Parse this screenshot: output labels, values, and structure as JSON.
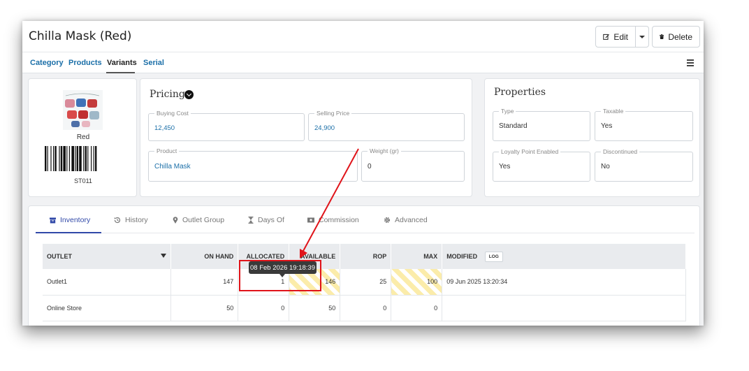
{
  "header": {
    "title": "Chilla Mask (Red)",
    "edit_label": "Edit",
    "delete_label": "Delete"
  },
  "tabs": [
    {
      "label": "Category"
    },
    {
      "label": "Products"
    },
    {
      "label": "Variants",
      "active": true
    },
    {
      "label": "Serial"
    }
  ],
  "variant": {
    "name": "Red",
    "sku": "ST011"
  },
  "pricing": {
    "title": "Pricing",
    "buying_cost_label": "Buying Cost",
    "buying_cost": "12,450",
    "selling_price_label": "Selling Price",
    "selling_price": "24,900",
    "product_label": "Product",
    "product": "Chilla Mask",
    "weight_label": "Weight (gr)",
    "weight": "0"
  },
  "properties": {
    "title": "Properties",
    "type_label": "Type",
    "type": "Standard",
    "taxable_label": "Taxable",
    "taxable": "Yes",
    "loyalty_label": "Loyalty Point Enabled",
    "loyalty": "Yes",
    "discontinued_label": "Discontinued",
    "discontinued": "No"
  },
  "sub_tabs": [
    {
      "label": "Inventory",
      "icon": "box-icon",
      "active": true
    },
    {
      "label": "History",
      "icon": "history-icon"
    },
    {
      "label": "Outlet Group",
      "icon": "map-marker-icon"
    },
    {
      "label": "Days Of",
      "icon": "hourglass-icon"
    },
    {
      "label": "Commission",
      "icon": "money-icon"
    },
    {
      "label": "Advanced",
      "icon": "gear-icon"
    }
  ],
  "inventory": {
    "columns": [
      "OUTLET",
      "ON HAND",
      "ALLOCATED",
      "AVAILABLE",
      "ROP",
      "MAX",
      "MODIFIED"
    ],
    "log_label": "LOG",
    "rows": [
      {
        "outlet": "Outlet1",
        "on_hand": "147",
        "allocated": "1",
        "available": "146",
        "rop": "25",
        "max": "100",
        "modified": "09 Jun 2025 13:20:34"
      },
      {
        "outlet": "Online Store",
        "on_hand": "50",
        "allocated": "0",
        "available": "50",
        "rop": "0",
        "max": "0",
        "modified": ""
      }
    ]
  },
  "tooltip": {
    "text": "08 Feb 2026 19:18:39"
  },
  "colors": {
    "link": "#1b6fa8",
    "active_tab": "#3149a8",
    "annotation": "#e0141a",
    "stripe": "#fbecaa"
  }
}
